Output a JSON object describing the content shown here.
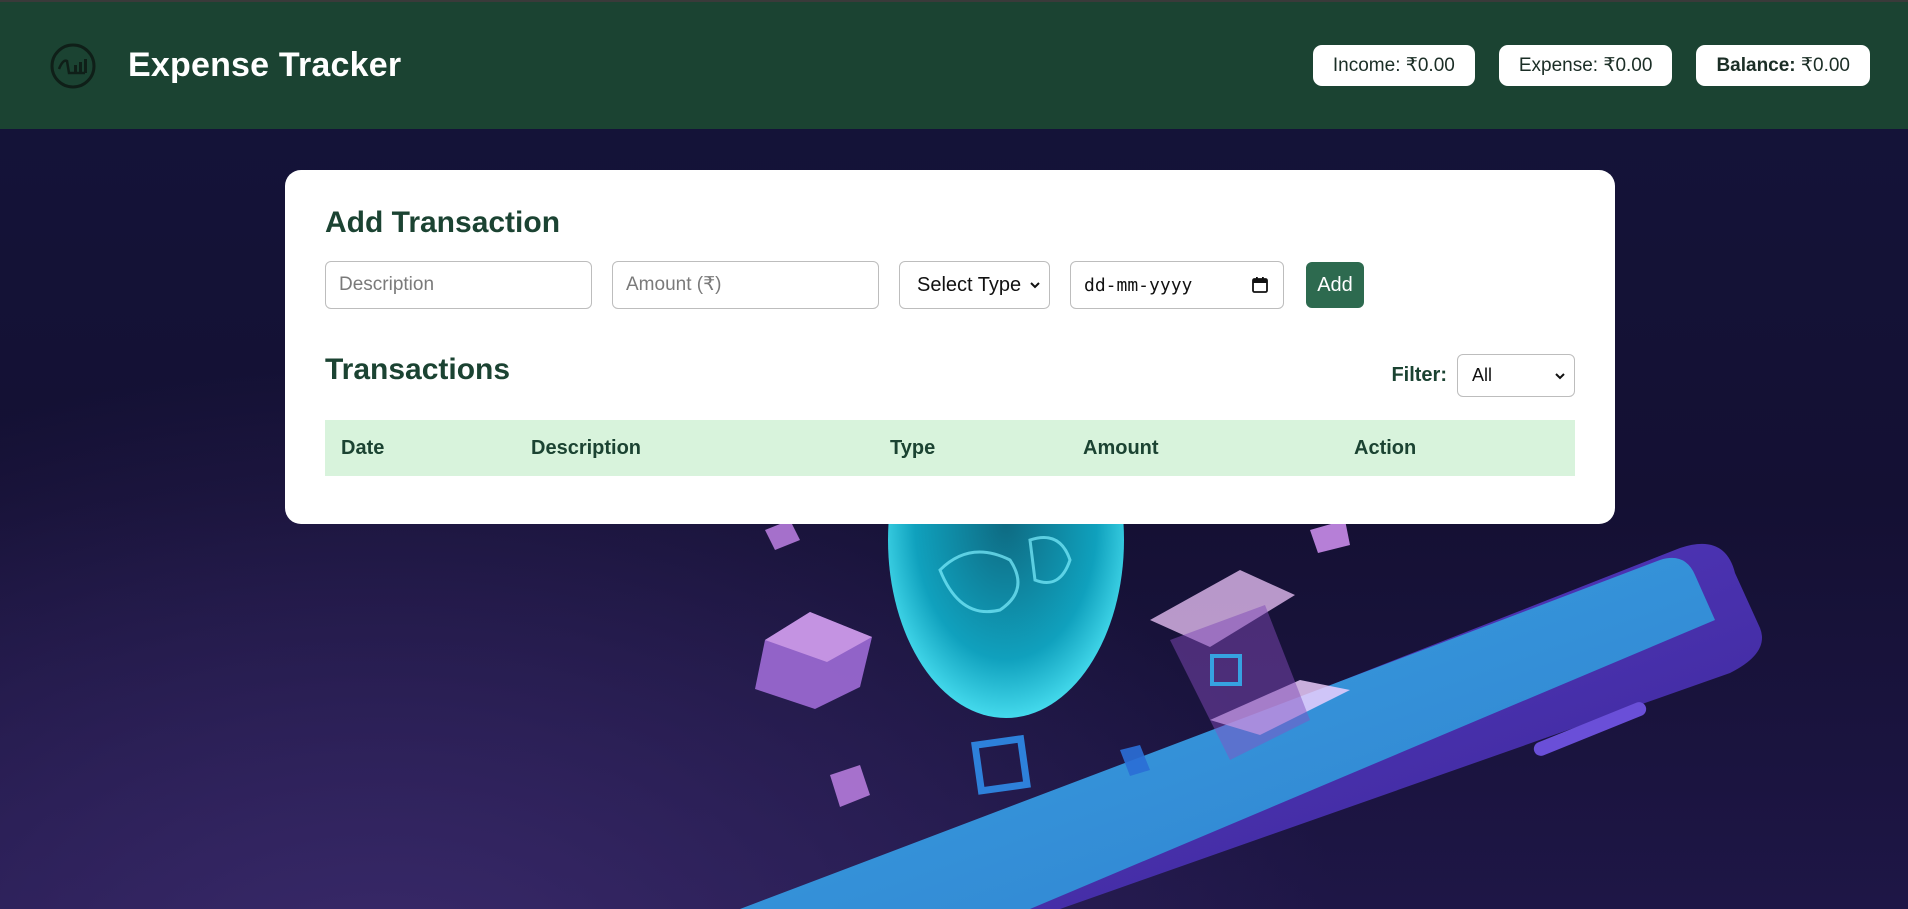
{
  "header": {
    "title": "Expense Tracker",
    "logo_icon": "chart-coin-logo-icon",
    "stats": {
      "income_label": "Income:",
      "income_value": "₹0.00",
      "expense_label": "Expense:",
      "expense_value": "₹0.00",
      "balance_label": "Balance:",
      "balance_value": "₹0.00"
    }
  },
  "add_transaction": {
    "title": "Add Transaction",
    "description_placeholder": "Description",
    "amount_placeholder": "Amount (₹)",
    "type_select_value": "Select Type",
    "date_placeholder": "dd-mm-yyyy",
    "add_button": "Add"
  },
  "transactions": {
    "title": "Transactions",
    "filter_label": "Filter:",
    "filter_value": "All",
    "columns": [
      "Date",
      "Description",
      "Type",
      "Amount",
      "Action"
    ],
    "rows": []
  },
  "colors": {
    "header_bg": "#1b4332",
    "accent_button": "#2d6a4f",
    "table_header_bg": "#d8f3dc",
    "title_text": "#1b4332"
  }
}
